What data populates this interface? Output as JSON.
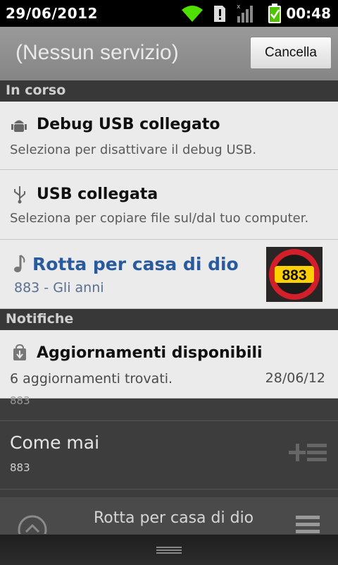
{
  "status_bar": {
    "date": "29/06/2012",
    "time": "00:48",
    "icons": [
      "wifi-icon",
      "alert-icon",
      "signal-icon",
      "battery-icon"
    ]
  },
  "header": {
    "title": "(Nessun servizio)",
    "cancel_label": "Cancella"
  },
  "sections": {
    "ongoing": "In corso",
    "notifications": "Notifiche"
  },
  "ongoing": [
    {
      "icon": "android-debug-icon",
      "title": "Debug USB collegato",
      "subtitle": "Seleziona per disattivare il debug USB."
    },
    {
      "icon": "usb-icon",
      "title": "USB collegata",
      "subtitle": "Seleziona per copiare file sul/dal tuo computer."
    }
  ],
  "music": {
    "icon": "music-note-icon",
    "title": "Rotta per casa di dio",
    "subtitle": "883 - Gli anni",
    "album_text": "883"
  },
  "notifications": [
    {
      "icon": "download-bag-icon",
      "title": "Aggiornamenti disponibili",
      "subtitle": "6 aggiornamenti trovati.",
      "date": "28/06/12"
    }
  ],
  "background_list": {
    "partial_artist": "883",
    "song_title": "Come mai",
    "song_artist": "883",
    "now_playing": "Rotta per casa di dio"
  },
  "colors": {
    "music_title": "#2a5a9e",
    "section_bg": "#383838",
    "panel_bg": "#ebebeb"
  }
}
